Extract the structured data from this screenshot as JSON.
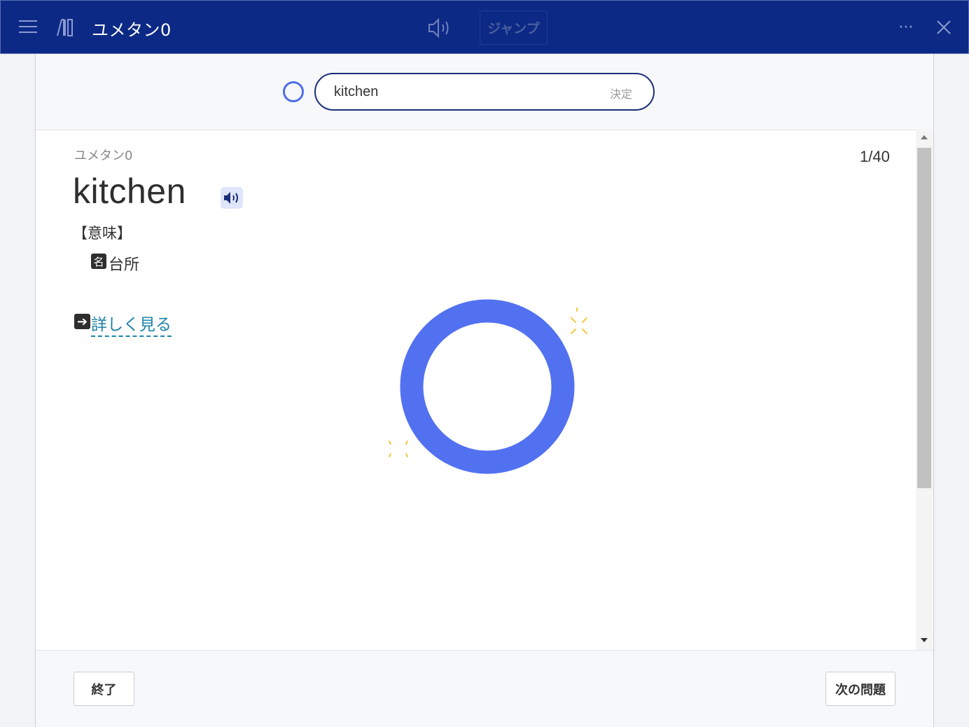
{
  "header": {
    "title": "ユメタン0",
    "jump_label": "ジャンプ",
    "more_label": "···"
  },
  "answer": {
    "value": "kitchen",
    "submit_label": "決定"
  },
  "card": {
    "deck_name": "ユメタン0",
    "counter": "1/40",
    "word": "kitchen",
    "meaning_label": "【意味】",
    "part_of_speech": "名",
    "meaning": "台所",
    "more_arrow": "➔",
    "more_link": "詳しく見る"
  },
  "footer": {
    "end_label": "終了",
    "next_label": "次の問題"
  },
  "colors": {
    "header_bg": "#0c2985",
    "correct_ring": "#5271f0",
    "link": "#1e84a8"
  }
}
